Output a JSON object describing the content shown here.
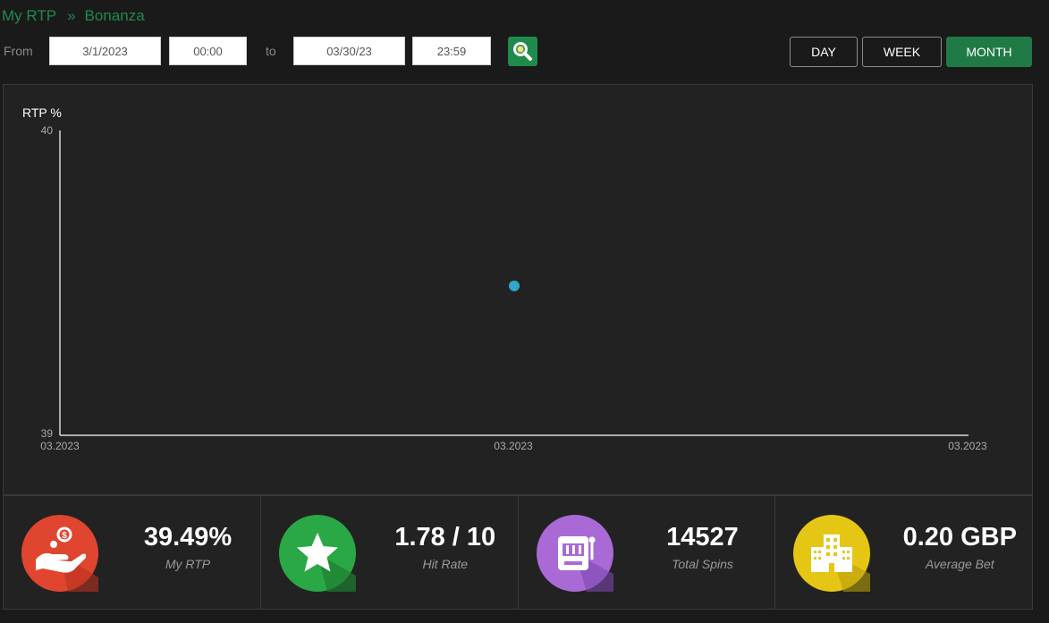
{
  "breadcrumb": {
    "parent": "My RTP",
    "separator": "»",
    "current": "Bonanza"
  },
  "filter": {
    "from_label": "From",
    "from_date": "3/1/2023",
    "from_time": "00:00",
    "to_label": "to",
    "to_date": "03/30/23",
    "to_time": "23:59"
  },
  "periods": {
    "day": "DAY",
    "week": "WEEK",
    "month": "MONTH",
    "active": "MONTH"
  },
  "colors": {
    "accent": "#1f8a4c",
    "active_button": "#1f7a45",
    "point": "#2fa7c9"
  },
  "chart_data": {
    "type": "scatter",
    "ylabel": "RTP %",
    "ylim": [
      39,
      40
    ],
    "y_ticks": [
      "40",
      "39"
    ],
    "x_ticks": [
      "03.2023",
      "03.2023",
      "03.2023"
    ],
    "points": [
      {
        "x": "03.2023",
        "y": 39.49
      }
    ],
    "grid": false
  },
  "stats": [
    {
      "value": "39.49%",
      "label": "My RTP",
      "icon": "money-hand-icon",
      "color": "#e0452f"
    },
    {
      "value": "1.78 / 10",
      "label": "Hit Rate",
      "icon": "star-icon",
      "color": "#2aa845"
    },
    {
      "value": "14527",
      "label": "Total Spins",
      "icon": "slot-machine-icon",
      "color": "#a96ad6"
    },
    {
      "value": "0.20 GBP",
      "label": "Average Bet",
      "icon": "building-icon",
      "color": "#e6c614"
    }
  ]
}
